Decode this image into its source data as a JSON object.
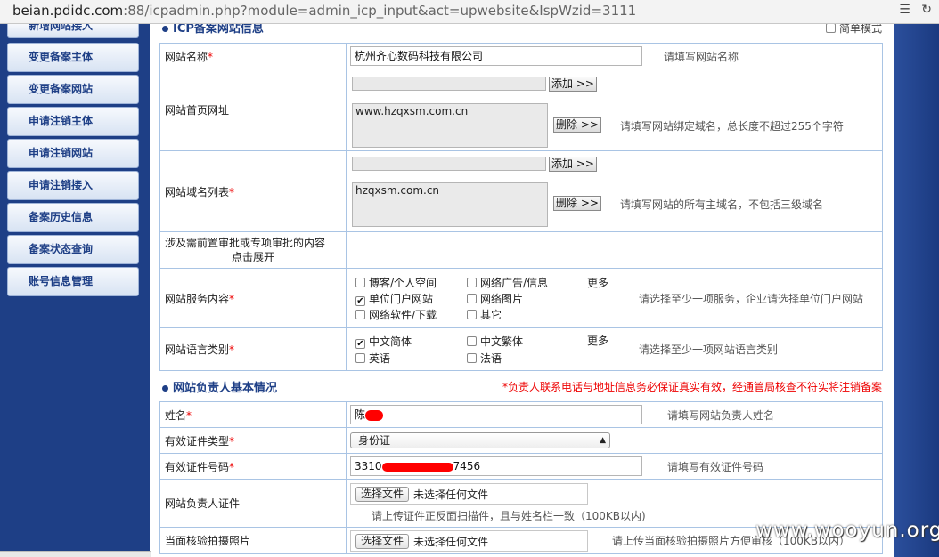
{
  "browser": {
    "url_host": "beian.pdidc.com",
    "url_rest": ":88/icpadmin.php?module=admin_icp_input&act=upwebsite&IspWzid=3111"
  },
  "sidebar": {
    "items": [
      {
        "label": "新增网站接入"
      },
      {
        "label": "变更备案主体"
      },
      {
        "label": "变更备案网站"
      },
      {
        "label": "申请注销主体"
      },
      {
        "label": "申请注销网站"
      },
      {
        "label": "申请注销接入"
      },
      {
        "label": "备案历史信息"
      },
      {
        "label": "备案状态查询"
      },
      {
        "label": "账号信息管理"
      }
    ]
  },
  "icp_section": {
    "title": "ICP备案网站信息",
    "simple_mode": "简单模式"
  },
  "site_form": {
    "site_name": {
      "label": "网站名称",
      "value": "杭州齐心数码科技有限公司",
      "hint": "请填写网站名称"
    },
    "site_home": {
      "label": "网站首页网址",
      "add": "添加 >>",
      "list_value": "www.hzqxsm.com.cn",
      "delete": "删除 >>",
      "hint": "请填写网站绑定域名，总长度不超过255个字符"
    },
    "domain_list": {
      "label": "网站域名列表",
      "add": "添加 >>",
      "list_value": "hzqxsm.com.cn",
      "delete": "删除 >>",
      "hint": "请填写网站的所有主域名，不包括三级域名"
    },
    "approval": {
      "label_line1": "涉及需前置审批或专项审批的内容",
      "label_line2": "点击展开"
    },
    "services": {
      "label": "网站服务内容",
      "options": [
        {
          "label": "博客/个人空间",
          "checked": false
        },
        {
          "label": "网络广告/信息",
          "checked": false
        },
        {
          "label": "单位门户网站",
          "checked": true
        },
        {
          "label": "网络图片",
          "checked": false
        },
        {
          "label": "网络软件/下载",
          "checked": false
        },
        {
          "label": "其它",
          "checked": false
        }
      ],
      "more": "更多",
      "hint": "请选择至少一项服务，企业请选择单位门户网站"
    },
    "languages": {
      "label": "网站语言类别",
      "options": [
        {
          "label": "中文简体",
          "checked": true
        },
        {
          "label": "中文繁体",
          "checked": false
        },
        {
          "label": "英语",
          "checked": false
        },
        {
          "label": "法语",
          "checked": false
        }
      ],
      "more": "更多",
      "hint": "请选择至少一项网站语言类别"
    }
  },
  "owner_section": {
    "title": "网站负责人基本情况",
    "warning": "*负责人联系电话与地址信息务必保证真实有效，经通管局核查不符实将注销备案"
  },
  "owner_form": {
    "name": {
      "label": "姓名",
      "value_prefix": "陈",
      "hint": "请填写网站负责人姓名"
    },
    "id_type": {
      "label": "有效证件类型",
      "value": "身份证"
    },
    "id_number": {
      "label": "有效证件号码",
      "value_prefix": "3310",
      "value_suffix": "7456",
      "hint": "请填写有效证件号码"
    },
    "id_cert": {
      "label": "网站负责人证件",
      "button": "选择文件",
      "status": "未选择任何文件",
      "hint": "请上传证件正反面扫描件，且与姓名栏一致（100KB以内)"
    },
    "photo": {
      "label": "当面核验拍摄照片",
      "button": "选择文件",
      "status": "未选择任何文件",
      "hint": "请上传当面核验拍摄照片方便审核（100KB以内）"
    }
  },
  "required_mark": "*",
  "watermark": "www.wooyun.org"
}
